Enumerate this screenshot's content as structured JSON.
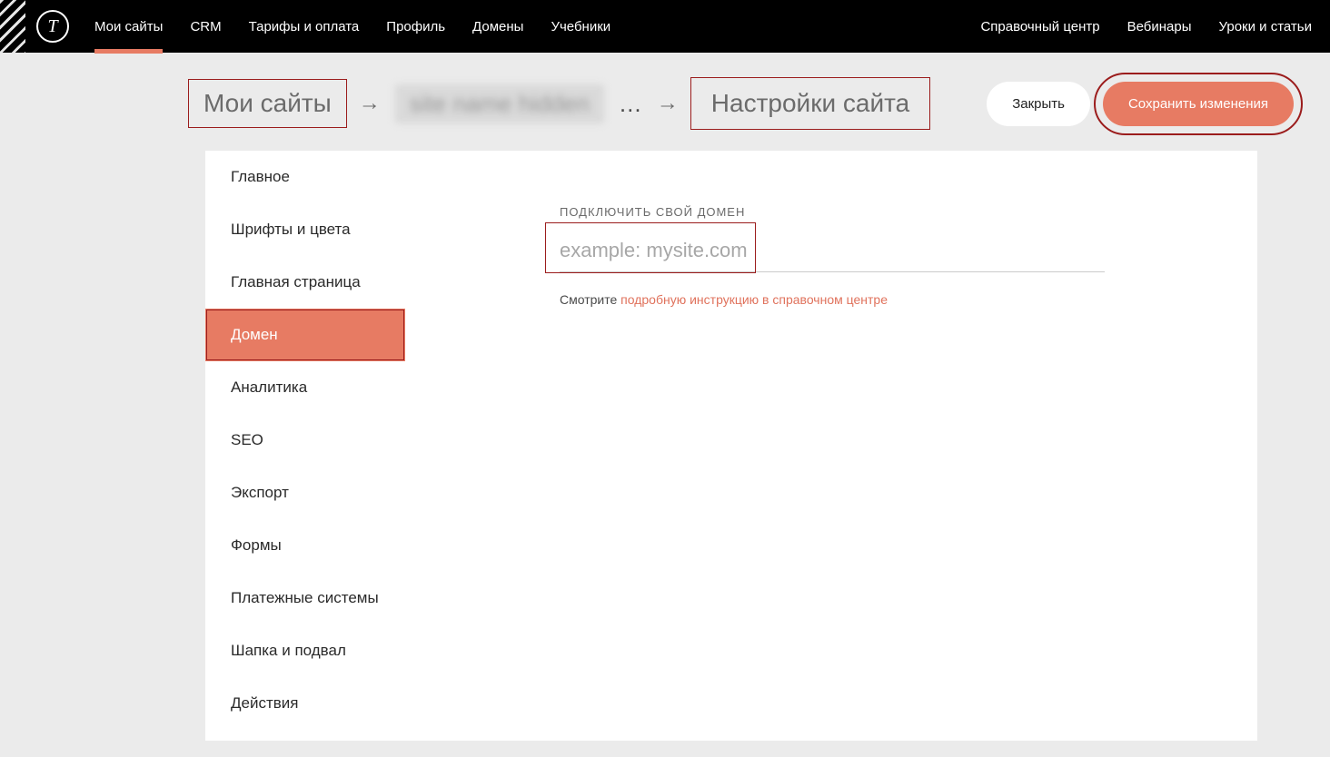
{
  "topnav": {
    "left": [
      "Мои сайты",
      "CRM",
      "Тарифы и оплата",
      "Профиль",
      "Домены",
      "Учебники"
    ],
    "right": [
      "Справочный центр",
      "Вебинары",
      "Уроки и статьи"
    ],
    "active_index": 0,
    "logo_letter": "T"
  },
  "breadcrumb": {
    "root": "Мои сайты",
    "site_placeholder": "…",
    "current": "Настройки сайта"
  },
  "actions": {
    "close": "Закрыть",
    "save": "Сохранить изменения"
  },
  "sidebar": {
    "items": [
      "Главное",
      "Шрифты и цвета",
      "Главная страница",
      "Домен",
      "Аналитика",
      "SEO",
      "Экспорт",
      "Формы",
      "Платежные системы",
      "Шапка и подвал",
      "Действия"
    ],
    "active_index": 3
  },
  "domain_section": {
    "label": "ПОДКЛЮЧИТЬ СВОЙ ДОМЕН",
    "placeholder": "example: mysite.com",
    "help_prefix": "Смотрите ",
    "help_link": "подробную инструкцию в справочном центре"
  }
}
